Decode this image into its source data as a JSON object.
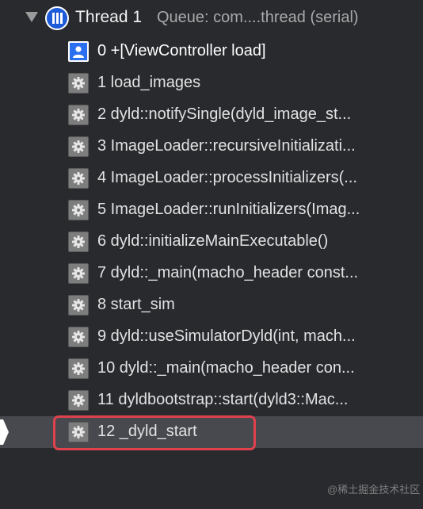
{
  "thread": {
    "title": "Thread 1",
    "queue": "Queue: com....thread (serial)"
  },
  "frames": [
    {
      "label": "0 +[ViewController load]",
      "icon": "user-code-icon"
    },
    {
      "label": "1 load_images",
      "icon": "gear-icon"
    },
    {
      "label": "2 dyld::notifySingle(dyld_image_st...",
      "icon": "gear-icon"
    },
    {
      "label": "3 ImageLoader::recursiveInitializati...",
      "icon": "gear-icon"
    },
    {
      "label": "4 ImageLoader::processInitializers(...",
      "icon": "gear-icon"
    },
    {
      "label": "5 ImageLoader::runInitializers(Imag...",
      "icon": "gear-icon"
    },
    {
      "label": "6 dyld::initializeMainExecutable()",
      "icon": "gear-icon"
    },
    {
      "label": "7 dyld::_main(macho_header const...",
      "icon": "gear-icon"
    },
    {
      "label": "8 start_sim",
      "icon": "gear-icon"
    },
    {
      "label": "9 dyld::useSimulatorDyld(int, mach...",
      "icon": "gear-icon"
    },
    {
      "label": "10 dyld::_main(macho_header con...",
      "icon": "gear-icon"
    },
    {
      "label": "11 dyldbootstrap::start(dyld3::Mac...",
      "icon": "gear-icon"
    },
    {
      "label": "12 _dyld_start",
      "icon": "gear-icon",
      "selected": true
    }
  ],
  "watermark": "@稀土掘金技术社区",
  "colors": {
    "background": "#282a2e",
    "selection": "#47494e",
    "highlight_border": "#e0424d",
    "thread_icon": "#1e5bd8",
    "user_frame_icon": "#2a6ff0",
    "system_frame_icon": "#7d7d7d"
  }
}
